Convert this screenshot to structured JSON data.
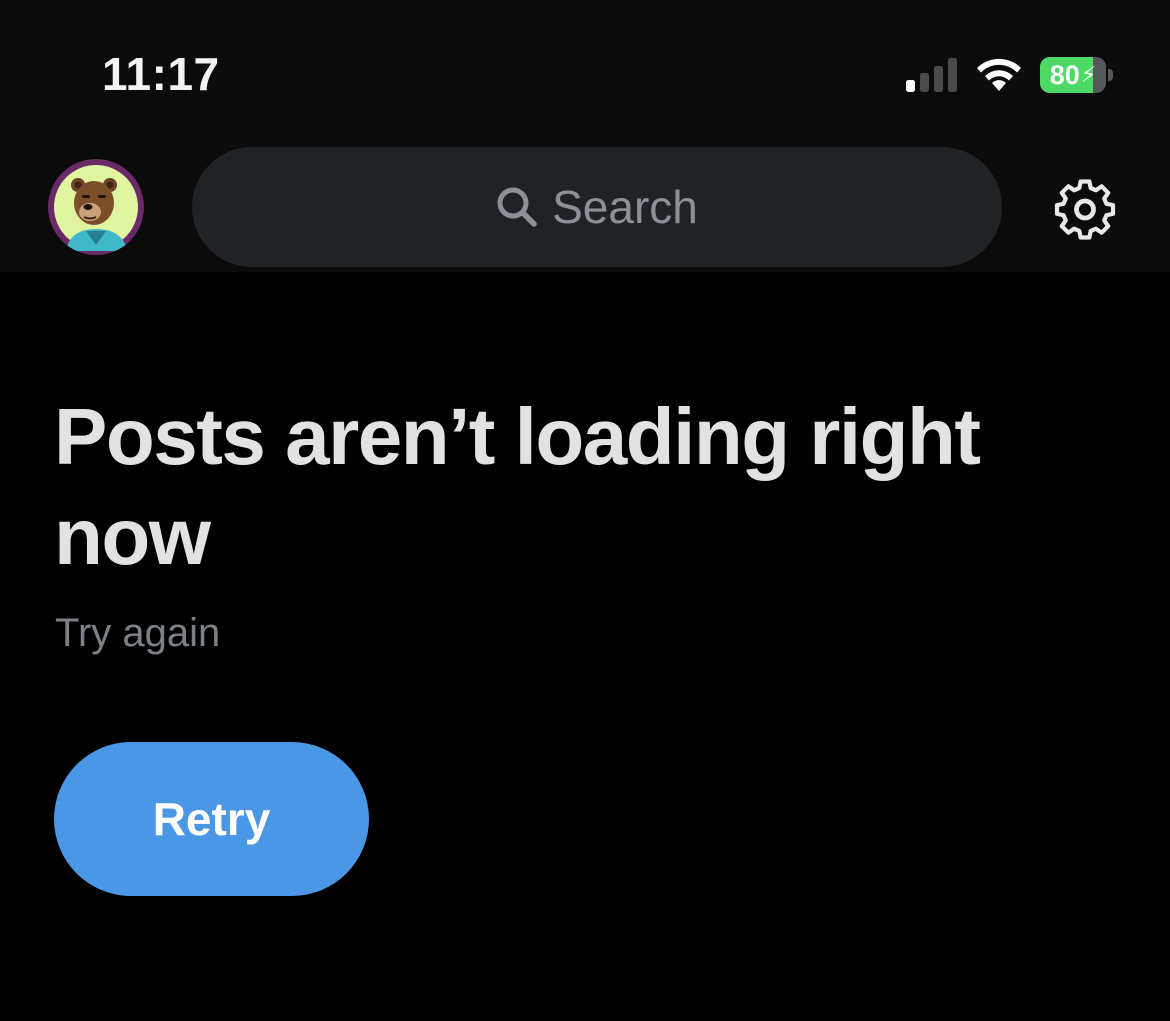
{
  "status_bar": {
    "time": "11:17",
    "battery_percent": "80",
    "battery_level": 0.8,
    "battery_color": "#4cd964",
    "signal_bars_active": 1,
    "signal_bars_total": 4,
    "icons": [
      "cellular-signal-icon",
      "wifi-icon",
      "battery-charging-icon"
    ]
  },
  "header": {
    "avatar_icon": "bear-avatar",
    "search": {
      "placeholder": "Search",
      "icon": "search-icon"
    },
    "settings_icon": "gear-icon"
  },
  "error": {
    "title": "Posts aren’t loading right now",
    "subtitle": "Try again",
    "retry_label": "Retry"
  },
  "colors": {
    "background": "#000000",
    "accent": "#4a97e6",
    "title_text": "#e2e2e2",
    "muted_text": "#7c8187",
    "search_bg": "#202326"
  }
}
